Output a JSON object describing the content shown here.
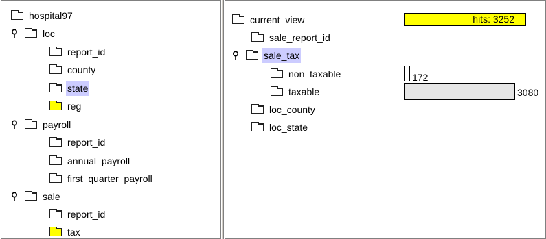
{
  "left_tree": {
    "root": {
      "label": "hospital97"
    },
    "loc": {
      "label": "loc",
      "children": [
        "report_id",
        "county",
        "state",
        "reg"
      ]
    },
    "payroll": {
      "label": "payroll",
      "children": [
        "report_id",
        "annual_payroll",
        "first_quarter_payroll"
      ]
    },
    "sale": {
      "label": "sale",
      "children": [
        "report_id",
        "tax"
      ]
    },
    "selected": "state",
    "highlighted_folders": [
      "reg",
      "tax"
    ]
  },
  "right_tree": {
    "root": {
      "label": "current_view"
    },
    "items": [
      "sale_report_id",
      "sale_tax",
      "loc_county",
      "loc_state"
    ],
    "sale_tax": {
      "label": "sale_tax",
      "children": [
        "non_taxable",
        "taxable"
      ]
    },
    "selected": "sale_tax"
  },
  "hits_badge": {
    "label": "hits: 3252",
    "color": "#ffff00"
  },
  "tax_counts": {
    "non_taxable": {
      "label": "172",
      "value": 172
    },
    "taxable": {
      "label": "3080",
      "value": 3080
    },
    "bar_color": "#e6e6e6"
  },
  "colors": {
    "selection": "#ccccff",
    "highlight_folder": "#ffff00"
  }
}
